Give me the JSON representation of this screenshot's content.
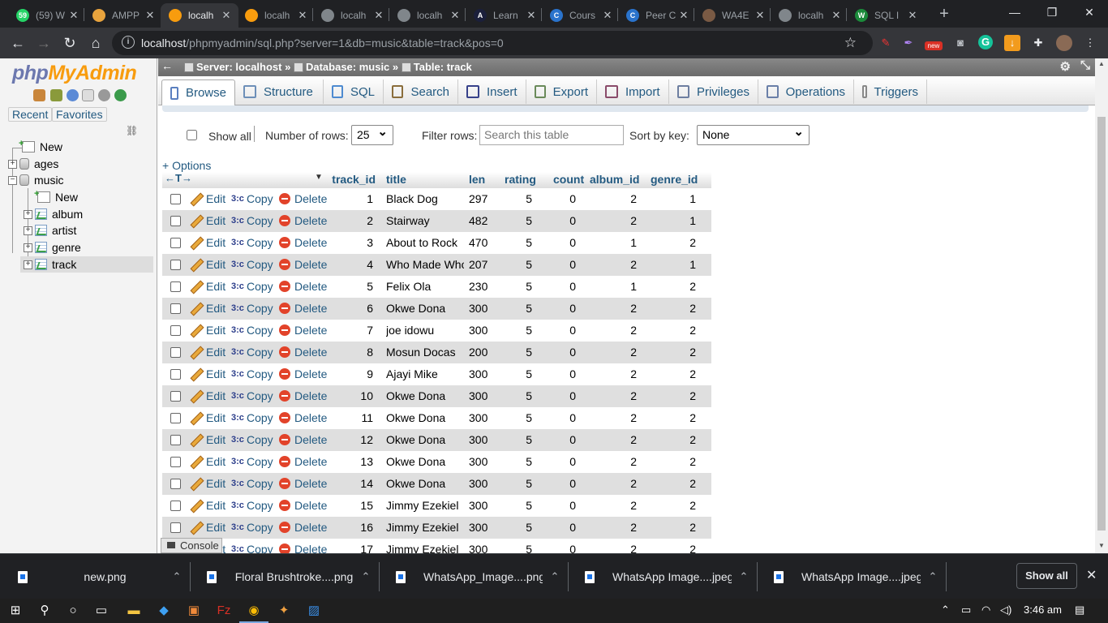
{
  "browser": {
    "tabs": [
      {
        "title": "(59) W",
        "fav_color": "#25d366",
        "fav_text": "59"
      },
      {
        "title": "AMPP",
        "fav_color": "#e8a33d",
        "fav_text": ""
      },
      {
        "title": "localh",
        "fav_color": "#f89c0e",
        "fav_text": ""
      },
      {
        "title": "localh",
        "fav_color": "#f89c0e",
        "fav_text": ""
      },
      {
        "title": "localh",
        "fav_color": "#80868b",
        "fav_text": ""
      },
      {
        "title": "localh",
        "fav_color": "#80868b",
        "fav_text": ""
      },
      {
        "title": "Learn",
        "fav_color": "#1b1f3b",
        "fav_text": "A"
      },
      {
        "title": "Cours",
        "fav_color": "#2a73cc",
        "fav_text": "C"
      },
      {
        "title": "Peer C",
        "fav_color": "#2a73cc",
        "fav_text": "C"
      },
      {
        "title": "WA4E",
        "fav_color": "#7a5a44",
        "fav_text": ""
      },
      {
        "title": "localh",
        "fav_color": "#80868b",
        "fav_text": ""
      },
      {
        "title": "SQL I",
        "fav_color": "#1b8a3a",
        "fav_text": "W"
      }
    ],
    "active_tab_index": 2,
    "url_host": "localhost",
    "url_path": "/phpmyadmin/sql.php?server=1&db=music&table=track&pos=0",
    "ext_badge": "new"
  },
  "pma_nav": {
    "logo_php": "php",
    "logo_my_admin": "MyAdmin",
    "recent_label": "Recent",
    "favorites_label": "Favorites",
    "tree": [
      {
        "label": "New",
        "type": "new",
        "level": 0
      },
      {
        "label": "ages",
        "type": "db",
        "level": 0
      },
      {
        "label": "music",
        "type": "db",
        "level": 0
      },
      {
        "label": "New",
        "type": "new",
        "level": 1
      },
      {
        "label": "album",
        "type": "table",
        "level": 1
      },
      {
        "label": "artist",
        "type": "table",
        "level": 1
      },
      {
        "label": "genre",
        "type": "table",
        "level": 1
      },
      {
        "label": "track",
        "type": "table",
        "level": 1,
        "selected": true
      }
    ]
  },
  "breadcrumb": {
    "server": "Server: localhost",
    "database": "Database: music",
    "table": "Table: track"
  },
  "tabs": [
    {
      "label": "Browse",
      "icon": "browse-icon",
      "color": "#5a7fbf"
    },
    {
      "label": "Structure",
      "icon": "structure-icon",
      "color": "#6d8fb8"
    },
    {
      "label": "SQL",
      "icon": "sql-icon",
      "color": "#4d8ad0"
    },
    {
      "label": "Search",
      "icon": "search-icon",
      "color": "#8a6d3b"
    },
    {
      "label": "Insert",
      "icon": "insert-icon",
      "color": "#37418a"
    },
    {
      "label": "Export",
      "icon": "export-icon",
      "color": "#6a8a5a"
    },
    {
      "label": "Import",
      "icon": "import-icon",
      "color": "#8a4b6a"
    },
    {
      "label": "Privileges",
      "icon": "privileges-icon",
      "color": "#6d7ea0"
    },
    {
      "label": "Operations",
      "icon": "operations-icon",
      "color": "#6a7fa8"
    },
    {
      "label": "Triggers",
      "icon": "triggers-icon",
      "color": "#888888"
    }
  ],
  "controls": {
    "show_all": "Show all",
    "rows_label": "Number of rows:",
    "rows_value": "25",
    "filter_label": "Filter rows:",
    "filter_placeholder": "Search this table",
    "sort_label": "Sort by key:",
    "sort_value": "None",
    "options_link": "+ Options"
  },
  "table": {
    "columns": [
      "track_id",
      "title",
      "len",
      "rating",
      "count",
      "album_id",
      "genre_id"
    ],
    "actions": {
      "edit": "Edit",
      "copy": "Copy",
      "delete": "Delete"
    },
    "rows": [
      [
        "1",
        "Black Dog",
        "297",
        "5",
        "0",
        "2",
        "1"
      ],
      [
        "2",
        "Stairway",
        "482",
        "5",
        "0",
        "2",
        "1"
      ],
      [
        "3",
        "About to Rock",
        "470",
        "5",
        "0",
        "1",
        "2"
      ],
      [
        "4",
        "Who Made Who",
        "207",
        "5",
        "0",
        "2",
        "1"
      ],
      [
        "5",
        "Felix Ola",
        "230",
        "5",
        "0",
        "1",
        "2"
      ],
      [
        "6",
        "Okwe Dona",
        "300",
        "5",
        "0",
        "2",
        "2"
      ],
      [
        "7",
        "joe idowu",
        "300",
        "5",
        "0",
        "2",
        "2"
      ],
      [
        "8",
        "Mosun Docas",
        "200",
        "5",
        "0",
        "2",
        "2"
      ],
      [
        "9",
        "Ajayi Mike",
        "300",
        "5",
        "0",
        "2",
        "2"
      ],
      [
        "10",
        "Okwe Dona",
        "300",
        "5",
        "0",
        "2",
        "2"
      ],
      [
        "11",
        "Okwe Dona",
        "300",
        "5",
        "0",
        "2",
        "2"
      ],
      [
        "12",
        "Okwe Dona",
        "300",
        "5",
        "0",
        "2",
        "2"
      ],
      [
        "13",
        "Okwe Dona",
        "300",
        "5",
        "0",
        "2",
        "2"
      ],
      [
        "14",
        "Okwe Dona",
        "300",
        "5",
        "0",
        "2",
        "2"
      ],
      [
        "15",
        "Jimmy Ezekiel",
        "300",
        "5",
        "0",
        "2",
        "2"
      ],
      [
        "16",
        "Jimmy Ezekiel",
        "300",
        "5",
        "0",
        "2",
        "2"
      ],
      [
        "17",
        "Jimmy Ezekiel",
        "300",
        "5",
        "0",
        "2",
        "2"
      ]
    ]
  },
  "console_label": "Console",
  "downloads": [
    "new.png",
    "Floral Brushtroke....png",
    "WhatsApp_Image....png",
    "WhatsApp Image....jpeg",
    "WhatsApp Image....jpeg"
  ],
  "downloads_show_all": "Show all",
  "taskbar": {
    "clock": "3:46 am"
  }
}
